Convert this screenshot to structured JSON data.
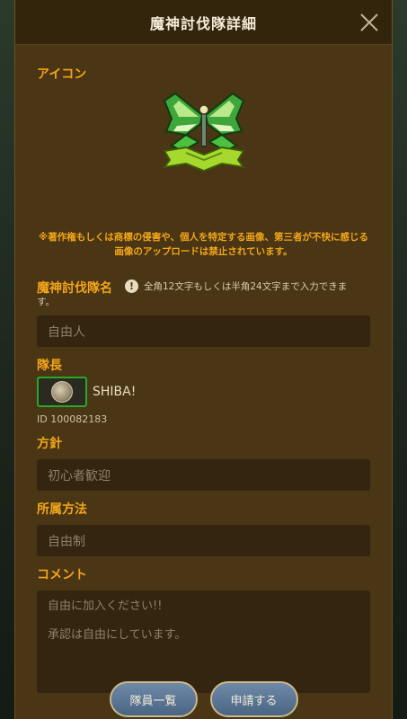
{
  "header": {
    "title": "魔神討伐隊詳細"
  },
  "icon_section": {
    "label": "アイコン"
  },
  "warning": {
    "line1": "※著作権もしくは商標の侵害や、個人を特定する画像、第三者が不快に感じる",
    "line2": "画像のアップロードは禁止されています。"
  },
  "team_name": {
    "label": "魔神討伐隊名",
    "info_glyph": "!",
    "hint": "全角12文字もしくは半角24文字まで入力できま",
    "hint_cont": "す。",
    "value": "自由人"
  },
  "leader": {
    "label": "隊長",
    "name": "SHIBA!",
    "id": "ID 100082183"
  },
  "policy": {
    "label": "方針",
    "value": "初心者歓迎"
  },
  "membership": {
    "label": "所属方法",
    "value": "自由制"
  },
  "comment": {
    "label": "コメント",
    "line1": "自由に加入ください!!",
    "line2": "承認は自由にしています。"
  },
  "buttons": {
    "members": "隊員一覧",
    "apply": "申請する"
  },
  "colors": {
    "accent": "#f2a619",
    "panel": "#4a3514",
    "header": "#33240c",
    "field": "#33250f",
    "button": "#5a7594",
    "avatar_border": "#28a828"
  }
}
